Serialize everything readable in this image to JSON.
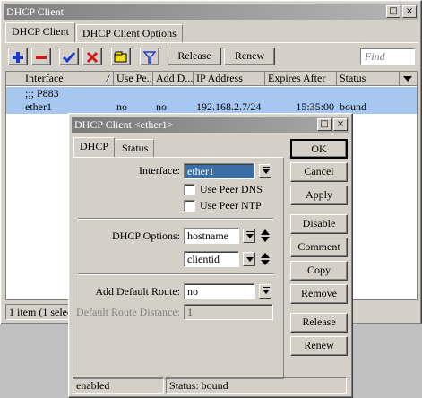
{
  "main_window": {
    "title": "DHCP Client",
    "title_buttons": [
      "□",
      "×"
    ],
    "tabs": [
      {
        "label": "DHCP Client"
      },
      {
        "label": "DHCP Client Options"
      }
    ],
    "toolbar": {
      "release_label": "Release",
      "renew_label": "Renew",
      "find_placeholder": "Find"
    },
    "table": {
      "columns": [
        "Interface",
        "Use Pe...",
        "Add D...",
        "IP Address",
        "Expires After",
        "Status"
      ],
      "sort_indicator": "/",
      "comment_row": ";;; P883",
      "rows": [
        {
          "interface": "ether1",
          "use_peer": "no",
          "add_default": "no",
          "ip_address": "192.168.2.7/24",
          "expires_after": "15:35:00",
          "status": "bound"
        }
      ]
    },
    "status_text": "1 item (1 selec"
  },
  "dialog": {
    "title": "DHCP Client <ether1>",
    "title_buttons": [
      "□",
      "×"
    ],
    "tabs": [
      {
        "label": "DHCP"
      },
      {
        "label": "Status"
      }
    ],
    "form": {
      "interface_label": "Interface:",
      "interface_value": "ether1",
      "use_peer_dns_label": "Use Peer DNS",
      "use_peer_ntp_label": "Use Peer NTP",
      "use_peer_dns_checked": false,
      "use_peer_ntp_checked": false,
      "dhcp_options_label": "DHCP Options:",
      "dhcp_options": [
        "hostname",
        "clientid"
      ],
      "add_default_route_label": "Add Default Route:",
      "add_default_route_value": "no",
      "default_route_distance_label": "Default Route Distance:",
      "default_route_distance_value": "1"
    },
    "buttons": {
      "ok": "OK",
      "cancel": "Cancel",
      "apply": "Apply",
      "disable": "Disable",
      "comment": "Comment",
      "copy": "Copy",
      "remove": "Remove",
      "release": "Release",
      "renew": "Renew"
    },
    "status_left": "enabled",
    "status_right": "Status: bound"
  },
  "colors": {
    "selection_blue": "#a6c8f0",
    "add_icon": "#1a3cc8",
    "remove_icon": "#c81a1a",
    "check_icon": "#1a3cc8",
    "cross_icon": "#c81a1a",
    "comment_icon": "#f0e020"
  }
}
